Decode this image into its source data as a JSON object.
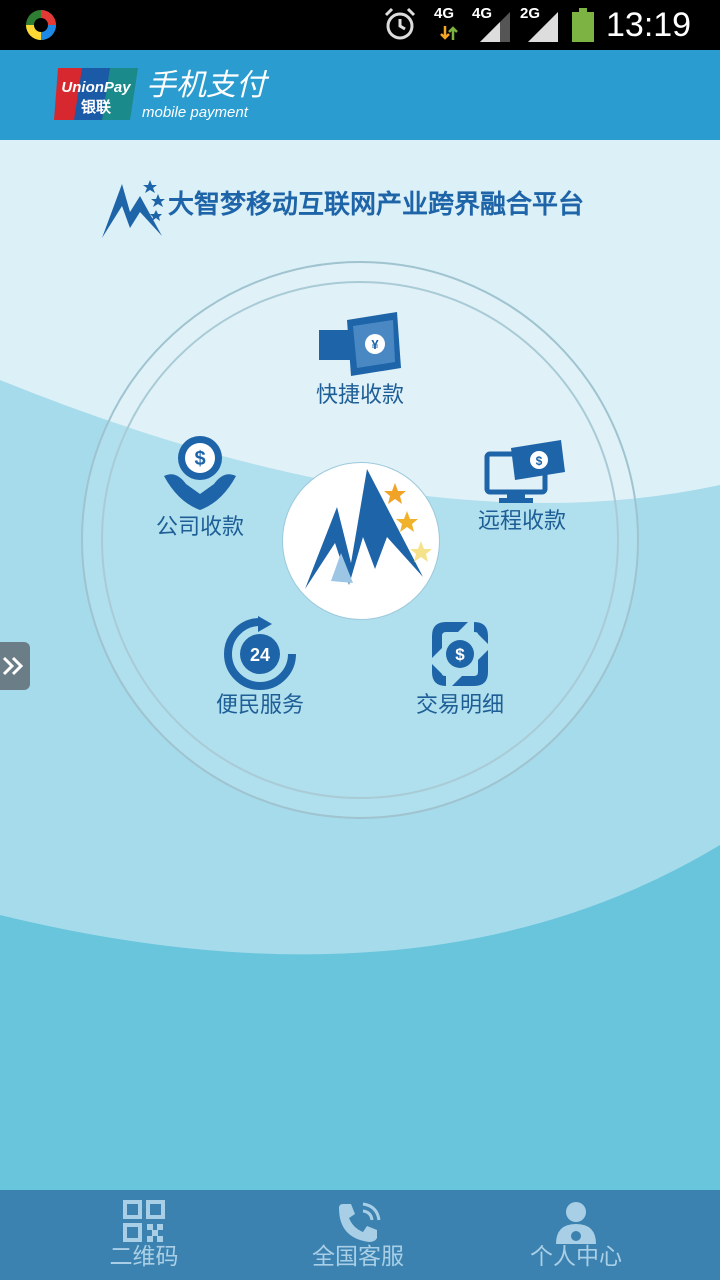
{
  "status_bar": {
    "time": "13:19",
    "network": [
      "4G",
      "4G",
      "2G"
    ]
  },
  "header": {
    "brand_top": "UnionPay",
    "brand_cn": "银联",
    "title": "手机支付",
    "subtitle": "mobile payment"
  },
  "platform": {
    "title": "大智梦移动互联网产业跨界融合平台"
  },
  "menu": {
    "items": [
      {
        "label": "快捷收款",
        "icon": "quick-receipt-icon"
      },
      {
        "label": "远程收款",
        "icon": "remote-receipt-icon"
      },
      {
        "label": "公司收款",
        "icon": "company-receipt-icon"
      },
      {
        "label": "便民服务",
        "icon": "24h-service-icon"
      },
      {
        "label": "交易明细",
        "icon": "transaction-detail-icon"
      }
    ]
  },
  "bottom_nav": {
    "items": [
      {
        "label": "二维码",
        "icon": "qr-code-icon"
      },
      {
        "label": "全国客服",
        "icon": "phone-icon"
      },
      {
        "label": "个人中心",
        "icon": "user-icon"
      }
    ]
  },
  "colors": {
    "header": "#2a9ccf",
    "bottom_nav": "#3b82b0",
    "accent_text": "#1e5e96",
    "background": "#68c5dc"
  }
}
